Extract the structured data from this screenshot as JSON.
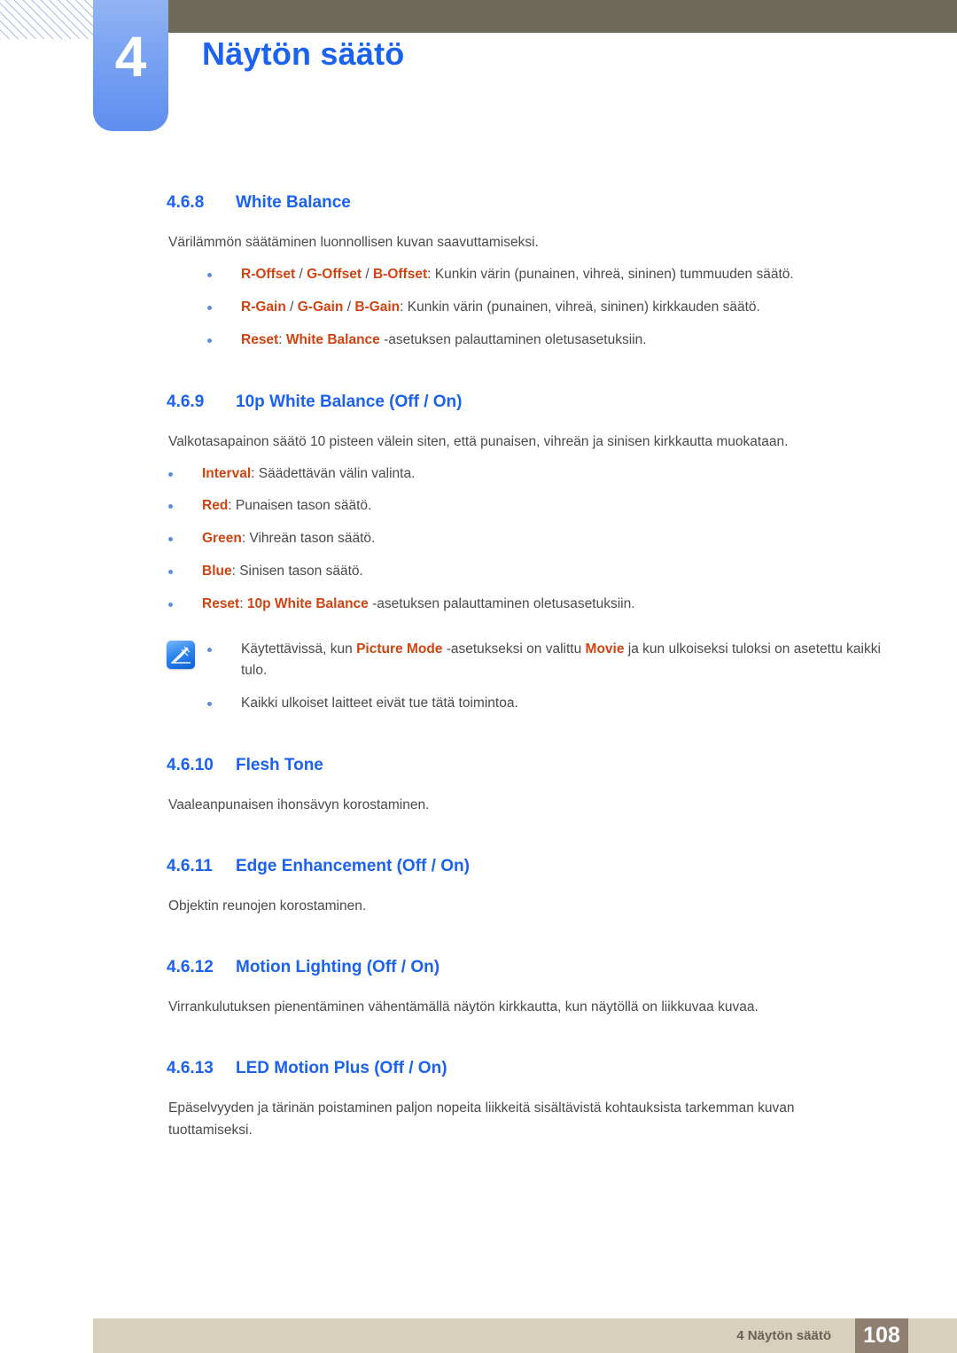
{
  "header": {
    "chapter_number": "4",
    "chapter_title": "Näytön säätö",
    "accent_blue": "#1a62ef",
    "olive_bar_color": "#6e6b58",
    "badge_gradient_from": "#92b4f4",
    "badge_gradient_to": "#5f8ef0"
  },
  "colors": {
    "heading_blue": "#1a62ef",
    "highlight_orange": "#cf4411",
    "body_gray": "#4a4a4a",
    "bullet_blue": "#5c8de0",
    "footer_beige": "#d6d0bc",
    "footer_page_brown": "#8e7f71"
  },
  "sections": [
    {
      "number": "4.6.8",
      "title": "White Balance",
      "paragraph": "Värilämmön säätäminen luonnollisen kuvan saavuttamiseksi.",
      "bullets": [
        {
          "parts": [
            {
              "text": "R-Offset",
              "style": "hl"
            },
            {
              "text": " / ",
              "style": "plain"
            },
            {
              "text": "G-Offset",
              "style": "hl"
            },
            {
              "text": " / ",
              "style": "plain"
            },
            {
              "text": "B-Offset",
              "style": "hl"
            },
            {
              "text": ": Kunkin värin (punainen, vihreä, sininen) tummuuden säätö.",
              "style": "plain"
            }
          ]
        },
        {
          "parts": [
            {
              "text": "R-Gain",
              "style": "hl"
            },
            {
              "text": " / ",
              "style": "plain"
            },
            {
              "text": "G-Gain",
              "style": "hl"
            },
            {
              "text": " / ",
              "style": "plain"
            },
            {
              "text": "B-Gain",
              "style": "hl"
            },
            {
              "text": ": Kunkin värin (punainen, vihreä, sininen) kirkkauden säätö.",
              "style": "plain"
            }
          ]
        },
        {
          "parts": [
            {
              "text": "Reset",
              "style": "hl"
            },
            {
              "text": ": ",
              "style": "plain"
            },
            {
              "text": "White Balance",
              "style": "hl"
            },
            {
              "text": " -asetuksen palauttaminen oletusasetuksiin.",
              "style": "plain"
            }
          ]
        }
      ]
    },
    {
      "number": "4.6.9",
      "title": "10p White Balance (Off / On)",
      "paragraph": "Valkotasapainon säätö 10 pisteen välein siten, että punaisen, vihreän ja sinisen kirkkautta muokataan.",
      "bullets": [
        {
          "parts": [
            {
              "text": "Interval",
              "style": "hl"
            },
            {
              "text": ": Säädettävän välin valinta.",
              "style": "plain"
            }
          ]
        },
        {
          "parts": [
            {
              "text": "Red",
              "style": "hl"
            },
            {
              "text": ": Punaisen tason säätö.",
              "style": "plain"
            }
          ]
        },
        {
          "parts": [
            {
              "text": "Green",
              "style": "hl"
            },
            {
              "text": ": Vihreän tason säätö.",
              "style": "plain"
            }
          ]
        },
        {
          "parts": [
            {
              "text": "Blue",
              "style": "hl"
            },
            {
              "text": ": Sinisen tason säätö.",
              "style": "plain"
            }
          ]
        },
        {
          "parts": [
            {
              "text": "Reset",
              "style": "hl"
            },
            {
              "text": ": ",
              "style": "plain"
            },
            {
              "text": "10p White Balance",
              "style": "hl"
            },
            {
              "text": " -asetuksen palauttaminen oletusasetuksiin.",
              "style": "plain"
            }
          ]
        }
      ],
      "note": {
        "icon": "note-pen-icon",
        "bullets": [
          {
            "parts": [
              {
                "text": "Käytettävissä, kun ",
                "style": "plain"
              },
              {
                "text": "Picture Mode",
                "style": "hl"
              },
              {
                "text": " -asetukseksi on valittu ",
                "style": "plain"
              },
              {
                "text": "Movie",
                "style": "hl"
              },
              {
                "text": " ja kun ulkoiseksi tuloksi on asetettu kaikki tulo.",
                "style": "plain"
              }
            ]
          },
          {
            "parts": [
              {
                "text": "Kaikki ulkoiset laitteet eivät tue tätä toimintoa.",
                "style": "plain"
              }
            ]
          }
        ]
      }
    },
    {
      "number": "4.6.10",
      "title": "Flesh Tone",
      "paragraph": "Vaaleanpunaisen ihonsävyn korostaminen.",
      "bullets": []
    },
    {
      "number": "4.6.11",
      "title": "Edge Enhancement (Off / On)",
      "paragraph": "Objektin reunojen korostaminen.",
      "bullets": []
    },
    {
      "number": "4.6.12",
      "title": "Motion Lighting (Off / On)",
      "paragraph": "Virrankulutuksen pienentäminen vähentämällä näytön kirkkautta, kun näytöllä on liikkuvaa kuvaa.",
      "bullets": []
    },
    {
      "number": "4.6.13",
      "title": "LED Motion Plus (Off / On)",
      "paragraph": "Epäselvyyden ja tärinän poistaminen paljon nopeita liikkeitä sisältävistä kohtauksista tarkemman kuvan tuottamiseksi.",
      "bullets": []
    }
  ],
  "footer": {
    "label": "4 Näytön säätö",
    "page_number": "108"
  }
}
